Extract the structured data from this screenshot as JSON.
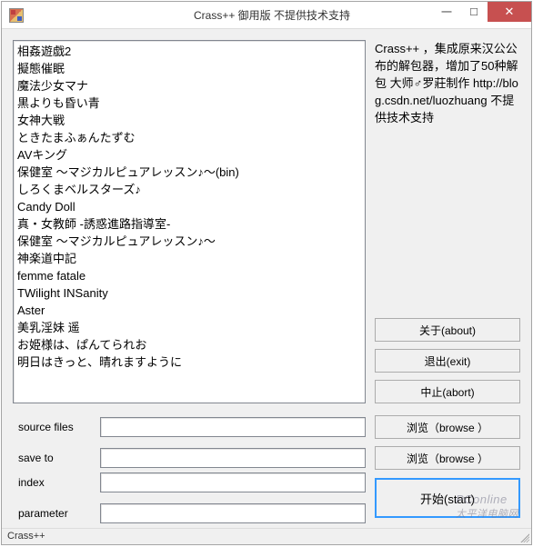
{
  "window": {
    "title": "Crass++  御用版 不提供技术支持"
  },
  "info": {
    "text": "Crass++ ，集成原来汉公公布的解包器，增加了50种解包 大师♂罗莊制作 http://blog.csdn.net/luozhuang    不提供技术支持"
  },
  "list": {
    "items": [
      "相姦遊戯2",
      "擬態催眠",
      "魔法少女マナ",
      "黒よりも昏い青",
      "女神大戦",
      "ときたまふぁんたずむ",
      "AVキング",
      "保健室 ～マジカルピュアレッスン♪～(bin)",
      "しろくまベルスターズ♪",
      "Candy Doll",
      "真・女教師 -誘惑進路指導室-",
      "保健室 ～マジカルピュアレッスン♪～",
      "神楽道中記",
      "femme fatale",
      "TWilight INSanity",
      "Aster",
      "美乳淫妹 遥",
      "お姫様は、ぱんてられお",
      "明日はきっと、晴れますように"
    ]
  },
  "buttons": {
    "about": "关于(about)",
    "exit": "退出(exit)",
    "abort": "中止(abort)",
    "browse": "浏览（browse ）",
    "start": "开始(start)"
  },
  "form": {
    "source_label": "source files",
    "save_label": "save to",
    "index_label": "index",
    "parameter_label": "parameter",
    "source_value": "",
    "save_value": "",
    "index_value": "",
    "parameter_value": ""
  },
  "status": {
    "text": "Crass++"
  },
  "watermark": {
    "line1": "PConline",
    "line2": "太平洋电脑网"
  }
}
